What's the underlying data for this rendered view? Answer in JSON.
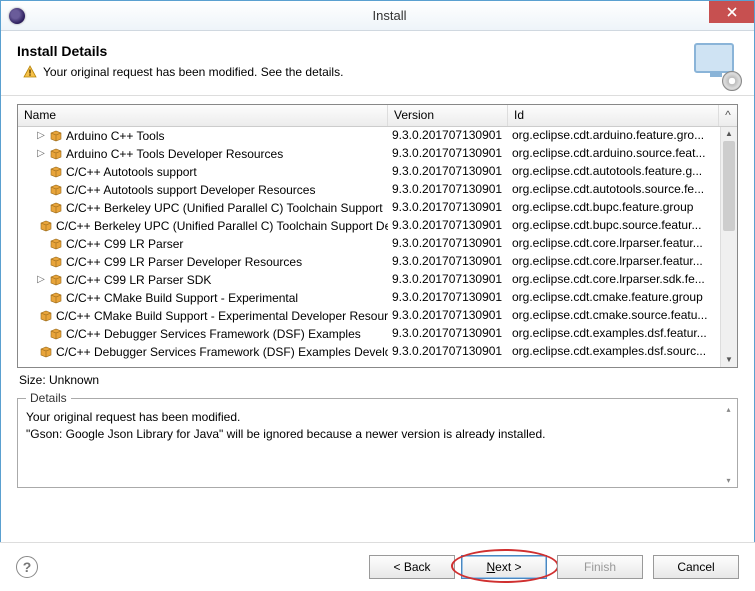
{
  "window": {
    "title": "Install"
  },
  "header": {
    "title": "Install Details",
    "message": "Your original request has been modified.  See the details."
  },
  "columns": {
    "name": "Name",
    "version": "Version",
    "id": "Id",
    "scroll_hint": "^"
  },
  "rows": [
    {
      "expand": "▷",
      "indent": 1,
      "name": "Arduino C++ Tools",
      "version": "9.3.0.201707130901",
      "id": "org.eclipse.cdt.arduino.feature.gro..."
    },
    {
      "expand": "▷",
      "indent": 1,
      "name": "Arduino C++ Tools Developer Resources",
      "version": "9.3.0.201707130901",
      "id": "org.eclipse.cdt.arduino.source.feat..."
    },
    {
      "expand": "",
      "indent": 1,
      "name": "C/C++ Autotools support",
      "version": "9.3.0.201707130901",
      "id": "org.eclipse.cdt.autotools.feature.g..."
    },
    {
      "expand": "",
      "indent": 1,
      "name": "C/C++ Autotools support Developer Resources",
      "version": "9.3.0.201707130901",
      "id": "org.eclipse.cdt.autotools.source.fe..."
    },
    {
      "expand": "",
      "indent": 1,
      "name": "C/C++ Berkeley UPC (Unified Parallel C) Toolchain Support",
      "version": "9.3.0.201707130901",
      "id": "org.eclipse.cdt.bupc.feature.group"
    },
    {
      "expand": "",
      "indent": 1,
      "name": "C/C++ Berkeley UPC (Unified Parallel C) Toolchain Support Dev",
      "version": "9.3.0.201707130901",
      "id": "org.eclipse.cdt.bupc.source.featur..."
    },
    {
      "expand": "",
      "indent": 1,
      "name": "C/C++ C99 LR Parser",
      "version": "9.3.0.201707130901",
      "id": "org.eclipse.cdt.core.lrparser.featur..."
    },
    {
      "expand": "",
      "indent": 1,
      "name": "C/C++ C99 LR Parser Developer Resources",
      "version": "9.3.0.201707130901",
      "id": "org.eclipse.cdt.core.lrparser.featur..."
    },
    {
      "expand": "▷",
      "indent": 1,
      "name": "C/C++ C99 LR Parser SDK",
      "version": "9.3.0.201707130901",
      "id": "org.eclipse.cdt.core.lrparser.sdk.fe..."
    },
    {
      "expand": "",
      "indent": 1,
      "name": "C/C++ CMake Build Support - Experimental",
      "version": "9.3.0.201707130901",
      "id": "org.eclipse.cdt.cmake.feature.group"
    },
    {
      "expand": "",
      "indent": 1,
      "name": "C/C++ CMake Build Support - Experimental Developer Resourc",
      "version": "9.3.0.201707130901",
      "id": "org.eclipse.cdt.cmake.source.featu..."
    },
    {
      "expand": "",
      "indent": 1,
      "name": "C/C++ Debugger Services Framework (DSF) Examples",
      "version": "9.3.0.201707130901",
      "id": "org.eclipse.cdt.examples.dsf.featur..."
    },
    {
      "expand": "",
      "indent": 1,
      "name": "C/C++ Debugger Services Framework (DSF) Examples Develope",
      "version": "9.3.0.201707130901",
      "id": "org.eclipse.cdt.examples.dsf.sourc..."
    }
  ],
  "size": "Size: Unknown",
  "details": {
    "label": "Details",
    "line1": "Your original request has been modified.",
    "line2": "  \"Gson: Google Json Library for Java\" will be ignored because a newer version is already installed."
  },
  "buttons": {
    "back": "< Back",
    "next_prefix": "N",
    "next_rest": "ext >",
    "finish": "Finish",
    "cancel": "Cancel"
  }
}
